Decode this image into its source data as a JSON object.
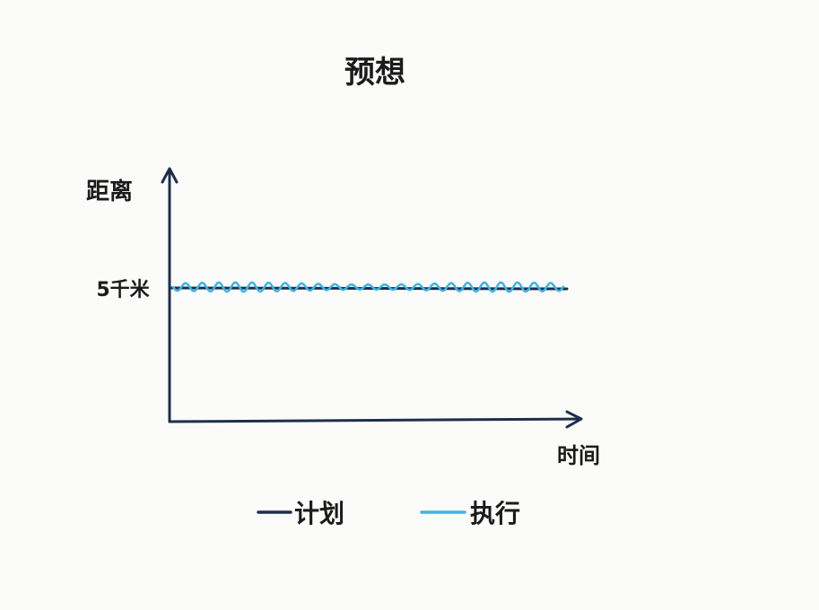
{
  "chart_data": {
    "type": "line",
    "title": "预想",
    "ylabel": "距离",
    "xlabel": "时间",
    "yticks": [
      "5千米"
    ],
    "series": [
      {
        "name": "计划",
        "color": "#1f2f4a",
        "style": "flat"
      },
      {
        "name": "执行",
        "color": "#3eb4e3",
        "style": "wavy"
      }
    ],
    "legend_position": "bottom",
    "grid": false
  }
}
